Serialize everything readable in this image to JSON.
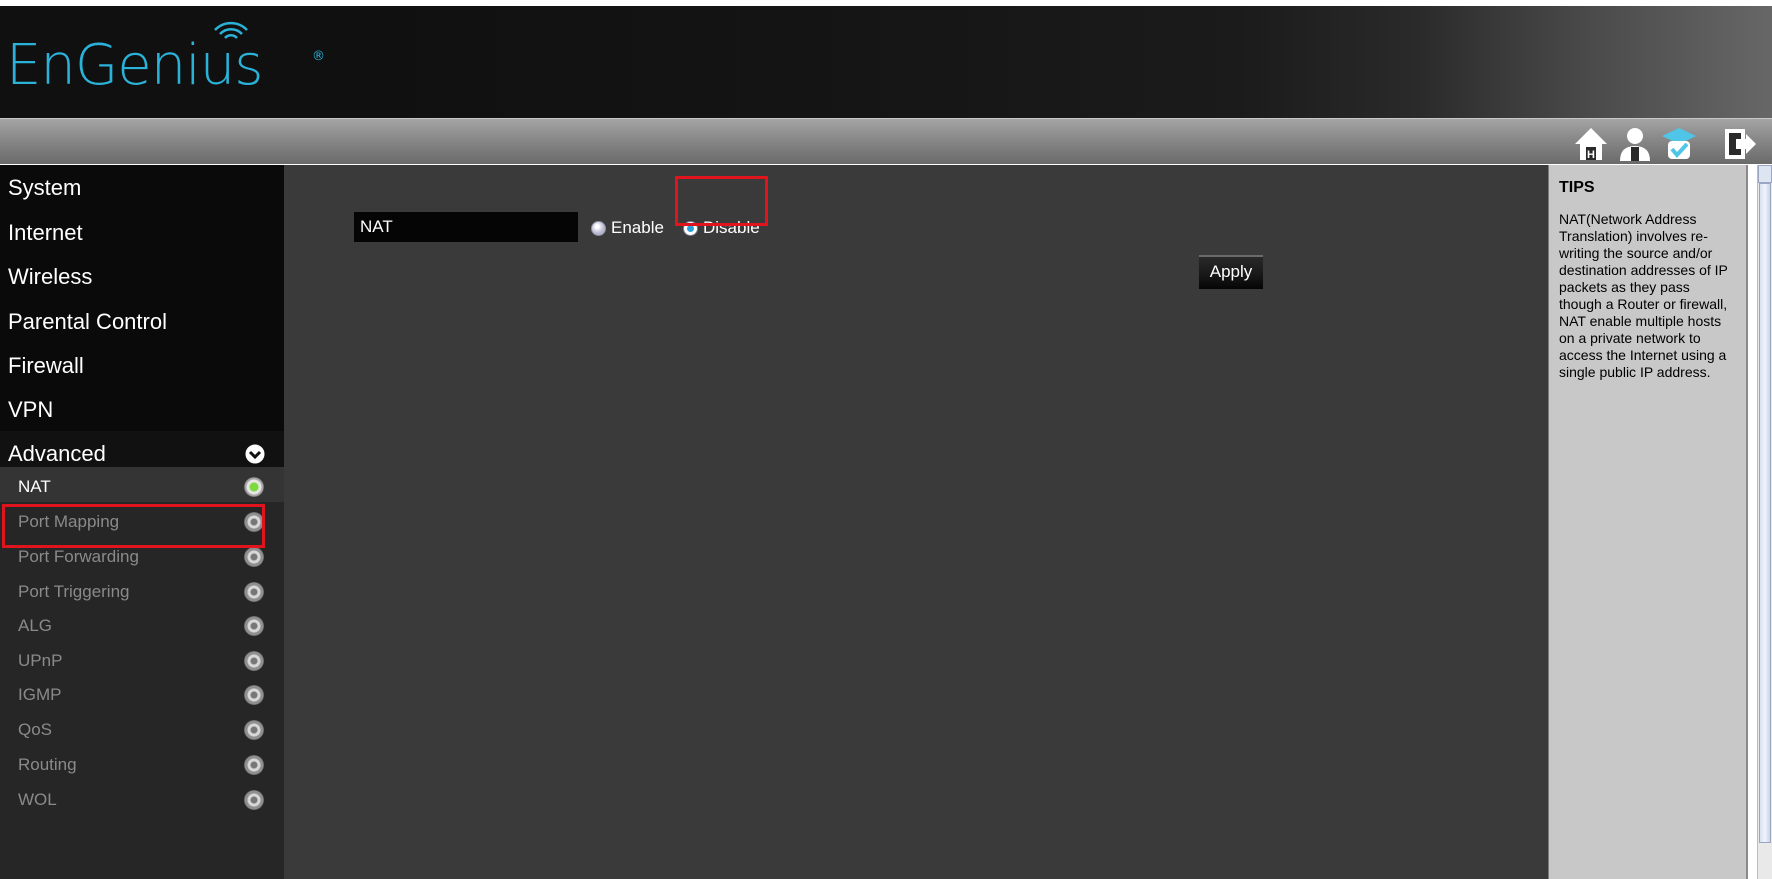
{
  "brand": {
    "logo_text": "EnGenius",
    "logo_mark": "®",
    "accent_color": "#2bb2d9"
  },
  "toolbar": {
    "icons": [
      "home-icon",
      "user-icon",
      "wizard-icon",
      "logout-icon"
    ]
  },
  "sidebar": {
    "items": [
      {
        "label": "System"
      },
      {
        "label": "Internet"
      },
      {
        "label": "Wireless"
      },
      {
        "label": "Parental Control"
      },
      {
        "label": "Firewall"
      },
      {
        "label": "VPN"
      },
      {
        "label": "Advanced",
        "expanded": true
      }
    ],
    "advanced_items": [
      {
        "label": "NAT",
        "active": true
      },
      {
        "label": "Port Mapping"
      },
      {
        "label": "Port Forwarding"
      },
      {
        "label": "Port Triggering"
      },
      {
        "label": "ALG"
      },
      {
        "label": "UPnP"
      },
      {
        "label": "IGMP"
      },
      {
        "label": "QoS"
      },
      {
        "label": "Routing"
      },
      {
        "label": "WOL"
      }
    ]
  },
  "main": {
    "nat_label": "NAT",
    "enable_label": "Enable",
    "disable_label": "Disable",
    "selected": "Disable",
    "apply_label": "Apply"
  },
  "tips": {
    "title": "TIPS",
    "text": "NAT(Network Address Translation) involves re-writing the source and/or destination addresses of IP packets as they pass though a Router or firewall, NAT enable multiple hosts on a private network to access the Internet using a single public IP address."
  },
  "colors": {
    "highlight": "#e0141c",
    "active_dot": "#7cd93e",
    "main_bg": "#3a3a3a",
    "sidebar_bg": "#0a0a0a",
    "tips_bg": "#c8c8c8"
  }
}
